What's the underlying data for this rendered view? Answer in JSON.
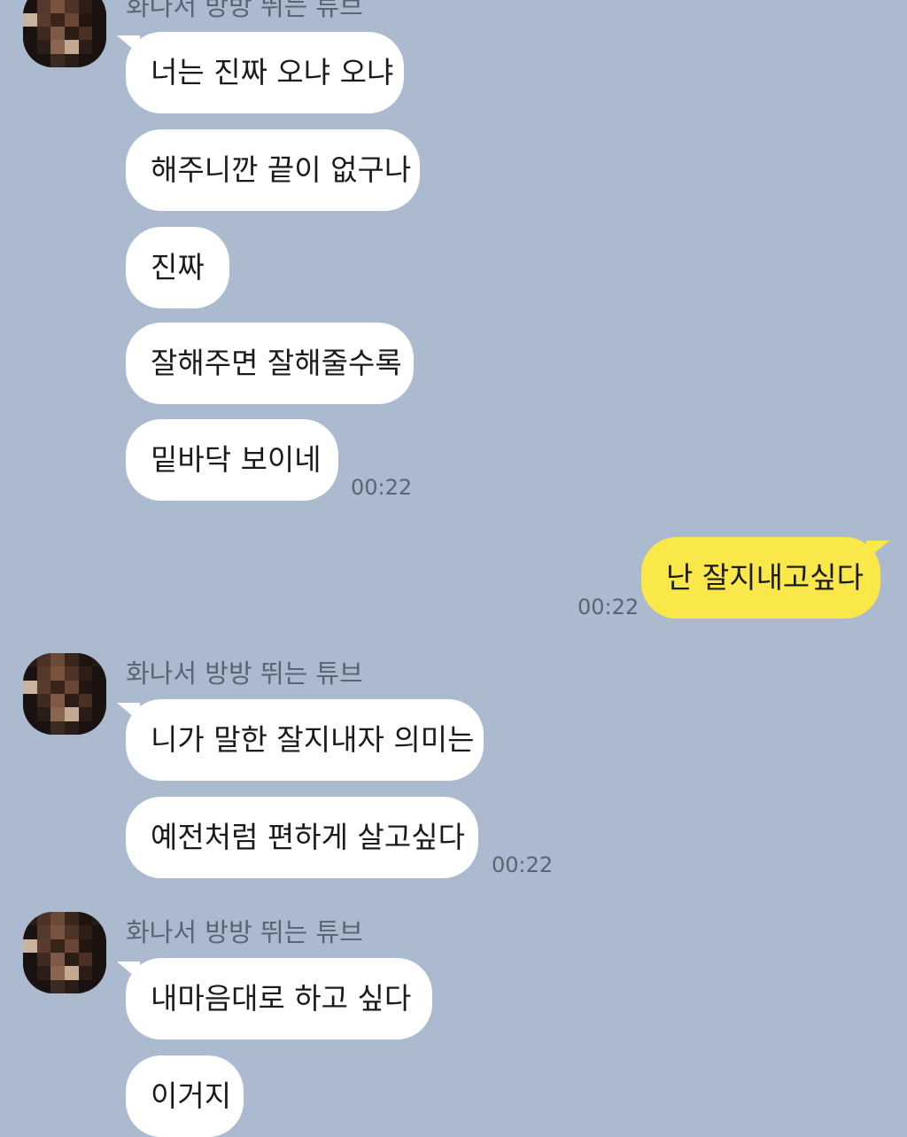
{
  "sender_name": "화나서 방방 뛰는 튜브",
  "messages": {
    "m1": "너는 진짜 오냐 오냐",
    "m2": "해주니깐 끝이 없구나",
    "m3": "진짜",
    "m4": "잘해주면 잘해줄수록",
    "m5": "밑바닥 보이네",
    "m6": "난 잘지내고싶다",
    "m7": "니가 말한 잘지내자 의미는",
    "m8": "예전처럼 편하게 살고싶다",
    "m9": "내마음대로 하고 싶다",
    "m10": "이거지"
  },
  "times": {
    "t1": "00:22",
    "t2": "00:22",
    "t3": "00:22"
  },
  "colors": {
    "background": "#abbace",
    "received_bubble": "#ffffff",
    "sent_bubble": "#fae84b"
  }
}
